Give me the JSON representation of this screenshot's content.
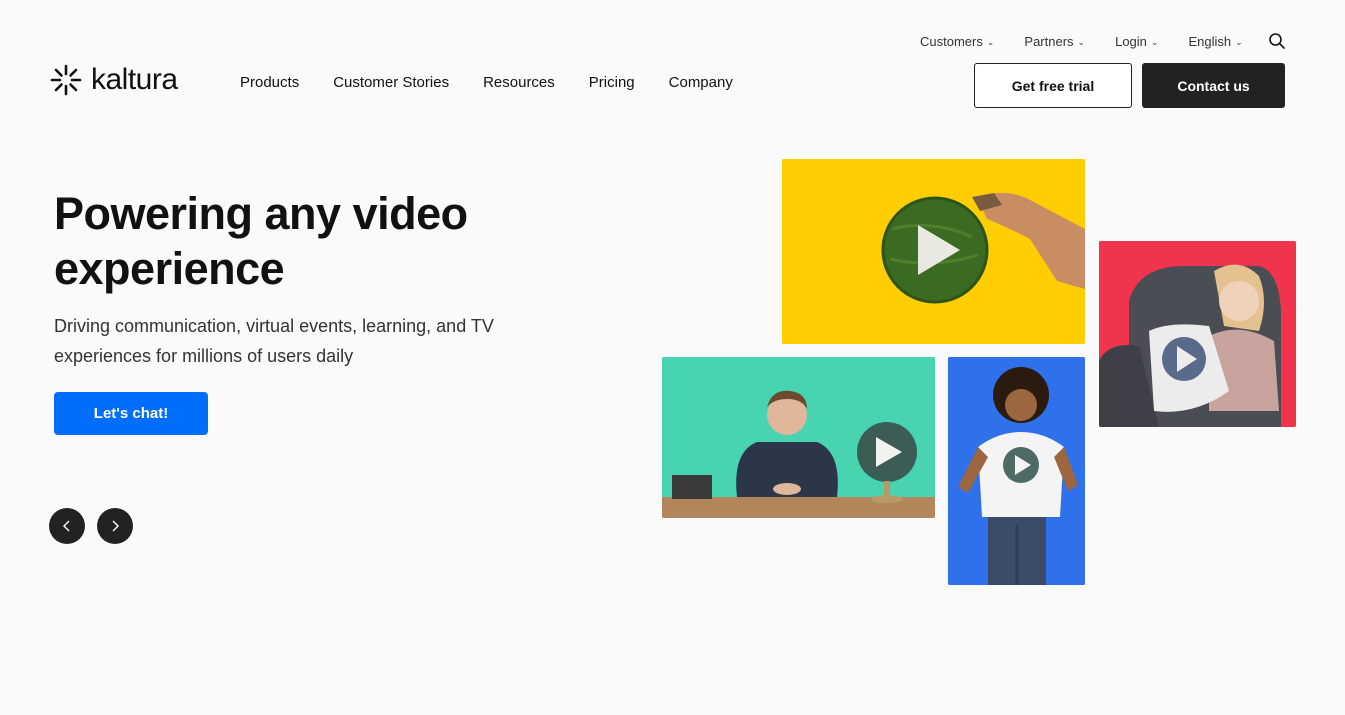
{
  "utility_nav": {
    "items": [
      {
        "label": "Customers"
      },
      {
        "label": "Partners"
      },
      {
        "label": "Login"
      },
      {
        "label": "English"
      }
    ]
  },
  "logo": {
    "text": "kaltura"
  },
  "main_nav": {
    "items": [
      {
        "label": "Products"
      },
      {
        "label": "Customer Stories"
      },
      {
        "label": "Resources"
      },
      {
        "label": "Pricing"
      },
      {
        "label": "Company"
      }
    ]
  },
  "header_buttons": {
    "trial_label": "Get free trial",
    "contact_label": "Contact us"
  },
  "hero": {
    "title_line1": "Powering any video",
    "title_line2": "experience",
    "subtitle_line1": "Driving communication, virtual events, learning, and TV",
    "subtitle_line2": "experiences for millions of users daily",
    "cta_label": "Let's chat!"
  },
  "colors": {
    "accent_blue": "#006efa",
    "dark": "#222222",
    "tile_yellow": "#ffcd00",
    "tile_green": "#48d3b1",
    "tile_blue": "#2e71ea",
    "tile_red": "#f0344e"
  },
  "icons": {
    "search": "search-icon",
    "chevron": "chevron-down-icon",
    "prev": "chevron-left-icon",
    "next": "chevron-right-icon",
    "play": "play-icon"
  }
}
